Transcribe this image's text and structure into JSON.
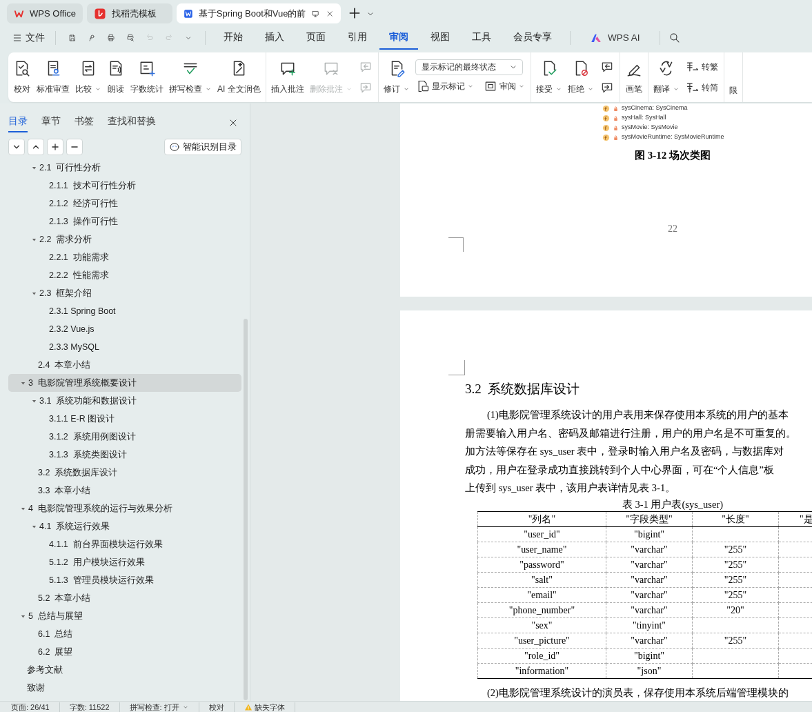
{
  "tabs": [
    {
      "label": "WPS Office",
      "kind": "home",
      "selected": false
    },
    {
      "label": "找稻壳模板",
      "kind": "template",
      "selected": false
    },
    {
      "label": "基于Spring Boot和Vue的前",
      "kind": "document",
      "selected": true
    }
  ],
  "menu": {
    "file_label": "文件",
    "quick_access": [
      {
        "kind": "save",
        "disabled": false
      },
      {
        "kind": "link",
        "disabled": false
      },
      {
        "kind": "print",
        "disabled": false
      },
      {
        "kind": "preview",
        "disabled": false
      },
      {
        "kind": "undo",
        "disabled": true
      },
      {
        "kind": "redo",
        "disabled": true
      },
      {
        "kind": "more",
        "disabled": false
      }
    ],
    "tabs": [
      {
        "label": "开始",
        "selected": false
      },
      {
        "label": "插入",
        "selected": false
      },
      {
        "label": "页面",
        "selected": false
      },
      {
        "label": "引用",
        "selected": false
      },
      {
        "label": "审阅",
        "selected": true
      },
      {
        "label": "视图",
        "selected": false
      },
      {
        "label": "工具",
        "selected": false
      },
      {
        "label": "会员专享",
        "selected": false
      }
    ],
    "ai_label": "WPS AI"
  },
  "ribbon": [
    {
      "items": [
        {
          "kind": "large",
          "label": "校对"
        },
        {
          "kind": "large",
          "label": "标准审查"
        },
        {
          "kind": "large",
          "label": "比较",
          "has_menu": true
        },
        {
          "kind": "large",
          "label": "朗读"
        },
        {
          "kind": "large",
          "label": "字数统计"
        },
        {
          "kind": "large",
          "label": "拼写检查",
          "has_menu": true
        },
        {
          "kind": "large",
          "label": "AI 全文润色"
        }
      ]
    },
    {
      "items": [
        {
          "kind": "large",
          "label": "插入批注",
          "disabled": false
        },
        {
          "kind": "large",
          "label": "删除批注",
          "has_menu": true,
          "disabled": true
        },
        {
          "kind": "stack",
          "items": [
            {
              "kind": "small",
              "disabled": true
            },
            {
              "kind": "small",
              "disabled": true
            }
          ]
        }
      ]
    },
    {
      "items": [
        {
          "kind": "large",
          "label": "修订",
          "has_menu": true
        },
        {
          "kind": "stack",
          "items": [
            {
              "kind": "select",
              "value": "显示标记的最终状态"
            },
            {
              "kind": "row",
              "items": [
                {
                  "kind": "small",
                  "label": "显示标记",
                  "has_menu": true
                },
                {
                  "kind": "small",
                  "label": "审阅",
                  "has_menu": true
                }
              ]
            }
          ]
        }
      ]
    },
    {
      "items": [
        {
          "kind": "large",
          "label": "接受",
          "has_menu": true
        },
        {
          "kind": "large",
          "label": "拒绝",
          "has_menu": true
        },
        {
          "kind": "stack",
          "items": [
            {
              "kind": "small"
            },
            {
              "kind": "small"
            }
          ]
        }
      ]
    },
    {
      "items": [
        {
          "kind": "large",
          "label": "画笔"
        }
      ]
    },
    {
      "items": [
        {
          "kind": "large",
          "label": "翻译",
          "has_menu": true
        },
        {
          "kind": "stack",
          "items": [
            {
              "kind": "small",
              "label": "转繁"
            },
            {
              "kind": "small",
              "label": "转简"
            }
          ]
        }
      ]
    },
    {
      "items": [
        {
          "kind": "label",
          "label": "限"
        }
      ]
    }
  ],
  "outline": {
    "tabs": [
      {
        "label": "目录",
        "selected": true
      },
      {
        "label": "章节",
        "selected": false
      },
      {
        "label": "书签",
        "selected": false
      },
      {
        "label": "查找和替换",
        "selected": false
      }
    ],
    "smart_button": "智能识别目录",
    "items": [
      {
        "children": [
          {
            "label": "2.1  可行性分析",
            "expanded": true,
            "selected": false,
            "children": [
              {
                "label": "2.1.1  技术可行性分析",
                "selected": false
              },
              {
                "label": "2.1.2  经济可行性",
                "selected": false
              },
              {
                "label": "2.1.3  操作可行性",
                "selected": false
              }
            ]
          },
          {
            "label": "2.2  需求分析",
            "expanded": true,
            "selected": false,
            "children": [
              {
                "label": "2.2.1  功能需求",
                "selected": false
              },
              {
                "label": "2.2.2  性能需求",
                "selected": false
              }
            ]
          },
          {
            "label": "2.3  框架介绍",
            "expanded": true,
            "selected": false,
            "children": [
              {
                "label": "2.3.1 Spring Boot",
                "selected": false
              },
              {
                "label": "2.3.2 Vue.js",
                "selected": false
              },
              {
                "label": "2.3.3 MySQL",
                "selected": false
              }
            ]
          },
          {
            "label": "2.4  本章小结",
            "selected": false
          }
        ]
      },
      {
        "label": "3  电影院管理系统概要设计",
        "expanded": true,
        "selected": true,
        "children": [
          {
            "label": "3.1  系统功能和数据设计",
            "expanded": true,
            "selected": false,
            "children": [
              {
                "label": "3.1.1 E-R 图设计",
                "selected": false
              },
              {
                "label": "3.1.2  系统用例图设计",
                "selected": false
              },
              {
                "label": "3.1.3  系统类图设计",
                "selected": false
              }
            ]
          },
          {
            "label": "3.2  系统数据库设计",
            "selected": false
          },
          {
            "label": "3.3  本章小结",
            "selected": false
          }
        ]
      },
      {
        "label": "4  电影院管理系统的运行与效果分析",
        "expanded": true,
        "selected": false,
        "children": [
          {
            "label": "4.1  系统运行效果",
            "expanded": true,
            "selected": false,
            "children": [
              {
                "label": "4.1.1  前台界面模块运行效果",
                "selected": false
              },
              {
                "label": "5.1.2  用户模块运行效果",
                "selected": false
              },
              {
                "label": "5.1.3  管理员模块运行效果",
                "selected": false
              }
            ]
          },
          {
            "label": "5.2  本章小结",
            "selected": false
          }
        ]
      },
      {
        "label": "5  总结与展望",
        "expanded": true,
        "selected": false,
        "children": [
          {
            "label": "6.1  总结",
            "selected": false
          },
          {
            "label": "6.2  展望",
            "selected": false
          }
        ]
      },
      {
        "label": "参考文献",
        "selected": false
      },
      {
        "label": "致谢",
        "selected": false
      }
    ]
  },
  "previous_page": {
    "class_fields": [
      "sysCinema: SysCinema",
      "sysHall: SysHall",
      "sysMovie: SysMovie",
      "sysMovieRuntime: SysMovieRuntime"
    ],
    "caption": "图 3-12  场次类图",
    "page_number": "22"
  },
  "current_page": {
    "heading": "3.2  系统数据库设计",
    "paragraph_lines": [
      "(1)电影院管理系统设计的用户表用来保存使用本系统的用户的基本",
      "册需要输入用户名、密码及邮箱进行注册，用户的用户名是不可重复的。",
      "加方法等保存在 sys_user 表中，登录时输入用户名及密码，与数据库对",
      "成功，用户在登录成功直接跳转到个人中心界面，可在“个人信息”板",
      "上传到 sys_user 表中，该用户表详情见表 3-1。"
    ],
    "table_caption": "表 3-1  用户表(sys_user)",
    "table": {
      "columns": [
        "\"列名\"",
        "\"字段类型\"",
        "\"长度\"",
        "\"是"
      ],
      "rows": [
        {
          "name": "\"user_id\"",
          "type": "\"bigint\""
        },
        {
          "name": "\"user_name\"",
          "type": "\"varchar\"",
          "length": "\"255\""
        },
        {
          "name": "\"password\"",
          "type": "\"varchar\"",
          "length": "\"255\""
        },
        {
          "name": "\"salt\"",
          "type": "\"varchar\"",
          "length": "\"255\""
        },
        {
          "name": "\"email\"",
          "type": "\"varchar\"",
          "length": "\"255\""
        },
        {
          "name": "\"phone_number\"",
          "type": "\"varchar\"",
          "length": "\"20\""
        },
        {
          "name": "\"sex\"",
          "type": "\"tinyint\""
        },
        {
          "name": "\"user_picture\"",
          "type": "\"varchar\"",
          "length": "\"255\""
        },
        {
          "name": "\"role_id\"",
          "type": "\"bigint\""
        },
        {
          "name": "\"information\"",
          "type": "\"json\""
        }
      ]
    },
    "next_paragraph": "(2)电影院管理系统设计的演员表，保存使用本系统后端管理模块的"
  },
  "status_bar": [
    {
      "kind": "plain",
      "text": "页面: 26/41"
    },
    {
      "kind": "plain",
      "text": "字数: 11522"
    },
    {
      "kind": "menu",
      "text": "拼写检查: 打开"
    },
    {
      "kind": "plain",
      "text": "校对"
    },
    {
      "kind": "warning",
      "text": "缺失字体"
    }
  ]
}
